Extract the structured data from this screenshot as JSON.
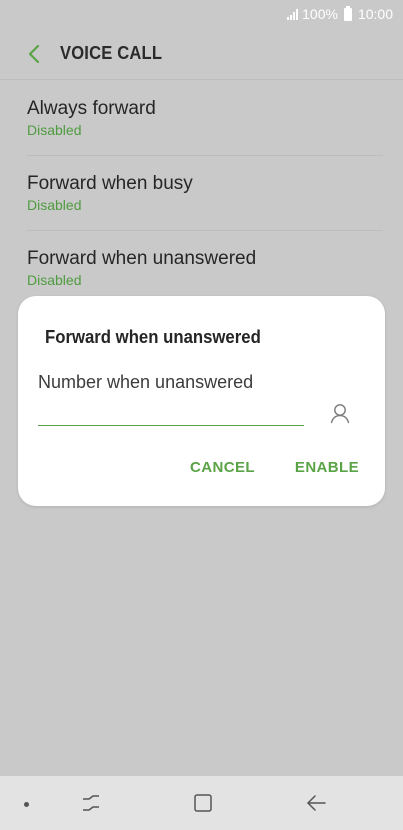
{
  "status_bar": {
    "battery": "100%",
    "time": "10:00"
  },
  "header": {
    "title": "VOICE CALL"
  },
  "list": {
    "items": [
      {
        "title": "Always forward",
        "status": "Disabled"
      },
      {
        "title": "Forward when busy",
        "status": "Disabled"
      },
      {
        "title": "Forward when unanswered",
        "status": "Disabled"
      }
    ]
  },
  "dialog": {
    "title": "Forward when unanswered",
    "input_label": "Number when unanswered",
    "input_value": "",
    "cancel_label": "CANCEL",
    "enable_label": "ENABLE"
  },
  "icons": {
    "back": "chevron-left-icon",
    "contact": "contact-icon",
    "recent": "recent-apps-icon",
    "home": "home-icon",
    "nav_back": "back-arrow-icon"
  },
  "colors": {
    "accent": "#5aa347",
    "status_green": "#4f9b3f",
    "background": "#c9c9c9",
    "dialog_bg": "#ffffff"
  }
}
